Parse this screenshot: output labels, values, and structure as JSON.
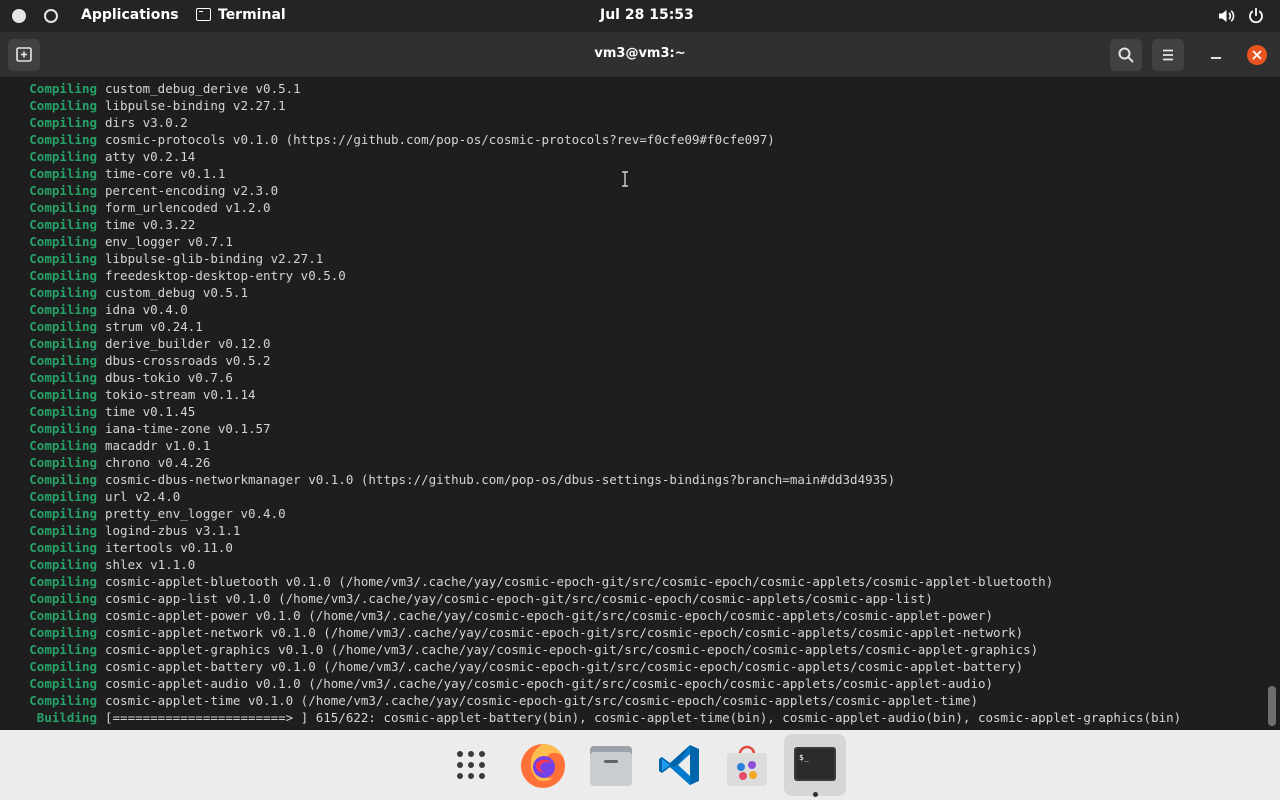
{
  "topbar": {
    "activities_icon": "workspace-dot-icon",
    "applications_label": "Applications",
    "active_app_label": "Terminal",
    "clock": "Jul 28  15:53"
  },
  "window": {
    "title": "vm3@vm3:~"
  },
  "terminal": {
    "status_color": "#26a269",
    "lines": [
      {
        "status": "Compiling",
        "text": "custom_debug_derive v0.5.1"
      },
      {
        "status": "Compiling",
        "text": "libpulse-binding v2.27.1"
      },
      {
        "status": "Compiling",
        "text": "dirs v3.0.2"
      },
      {
        "status": "Compiling",
        "text": "cosmic-protocols v0.1.0 (https://github.com/pop-os/cosmic-protocols?rev=f0cfe09#f0cfe097)"
      },
      {
        "status": "Compiling",
        "text": "atty v0.2.14"
      },
      {
        "status": "Compiling",
        "text": "time-core v0.1.1"
      },
      {
        "status": "Compiling",
        "text": "percent-encoding v2.3.0"
      },
      {
        "status": "Compiling",
        "text": "form_urlencoded v1.2.0"
      },
      {
        "status": "Compiling",
        "text": "time v0.3.22"
      },
      {
        "status": "Compiling",
        "text": "env_logger v0.7.1"
      },
      {
        "status": "Compiling",
        "text": "libpulse-glib-binding v2.27.1"
      },
      {
        "status": "Compiling",
        "text": "freedesktop-desktop-entry v0.5.0"
      },
      {
        "status": "Compiling",
        "text": "custom_debug v0.5.1"
      },
      {
        "status": "Compiling",
        "text": "idna v0.4.0"
      },
      {
        "status": "Compiling",
        "text": "strum v0.24.1"
      },
      {
        "status": "Compiling",
        "text": "derive_builder v0.12.0"
      },
      {
        "status": "Compiling",
        "text": "dbus-crossroads v0.5.2"
      },
      {
        "status": "Compiling",
        "text": "dbus-tokio v0.7.6"
      },
      {
        "status": "Compiling",
        "text": "tokio-stream v0.1.14"
      },
      {
        "status": "Compiling",
        "text": "time v0.1.45"
      },
      {
        "status": "Compiling",
        "text": "iana-time-zone v0.1.57"
      },
      {
        "status": "Compiling",
        "text": "macaddr v1.0.1"
      },
      {
        "status": "Compiling",
        "text": "chrono v0.4.26"
      },
      {
        "status": "Compiling",
        "text": "cosmic-dbus-networkmanager v0.1.0 (https://github.com/pop-os/dbus-settings-bindings?branch=main#dd3d4935)"
      },
      {
        "status": "Compiling",
        "text": "url v2.4.0"
      },
      {
        "status": "Compiling",
        "text": "pretty_env_logger v0.4.0"
      },
      {
        "status": "Compiling",
        "text": "logind-zbus v3.1.1"
      },
      {
        "status": "Compiling",
        "text": "itertools v0.11.0"
      },
      {
        "status": "Compiling",
        "text": "shlex v1.1.0"
      },
      {
        "status": "Compiling",
        "text": "cosmic-applet-bluetooth v0.1.0 (/home/vm3/.cache/yay/cosmic-epoch-git/src/cosmic-epoch/cosmic-applets/cosmic-applet-bluetooth)"
      },
      {
        "status": "Compiling",
        "text": "cosmic-app-list v0.1.0 (/home/vm3/.cache/yay/cosmic-epoch-git/src/cosmic-epoch/cosmic-applets/cosmic-app-list)"
      },
      {
        "status": "Compiling",
        "text": "cosmic-applet-power v0.1.0 (/home/vm3/.cache/yay/cosmic-epoch-git/src/cosmic-epoch/cosmic-applets/cosmic-applet-power)"
      },
      {
        "status": "Compiling",
        "text": "cosmic-applet-network v0.1.0 (/home/vm3/.cache/yay/cosmic-epoch-git/src/cosmic-epoch/cosmic-applets/cosmic-applet-network)"
      },
      {
        "status": "Compiling",
        "text": "cosmic-applet-graphics v0.1.0 (/home/vm3/.cache/yay/cosmic-epoch-git/src/cosmic-epoch/cosmic-applets/cosmic-applet-graphics)"
      },
      {
        "status": "Compiling",
        "text": "cosmic-applet-battery v0.1.0 (/home/vm3/.cache/yay/cosmic-epoch-git/src/cosmic-epoch/cosmic-applets/cosmic-applet-battery)"
      },
      {
        "status": "Compiling",
        "text": "cosmic-applet-audio v0.1.0 (/home/vm3/.cache/yay/cosmic-epoch-git/src/cosmic-epoch/cosmic-applets/cosmic-applet-audio)"
      },
      {
        "status": "Compiling",
        "text": "cosmic-applet-time v0.1.0 (/home/vm3/.cache/yay/cosmic-epoch-git/src/cosmic-epoch/cosmic-applets/cosmic-applet-time)"
      },
      {
        "status": "Building",
        "text": "[=======================> ] 615/622: cosmic-applet-battery(bin), cosmic-applet-time(bin), cosmic-applet-audio(bin), cosmic-applet-graphics(bin)"
      }
    ]
  },
  "dock": {
    "items": [
      {
        "name": "app-grid",
        "icon": "app-grid-icon"
      },
      {
        "name": "firefox",
        "icon": "firefox-icon"
      },
      {
        "name": "files",
        "icon": "files-icon"
      },
      {
        "name": "vscode",
        "icon": "vscode-icon"
      },
      {
        "name": "software-store",
        "icon": "store-icon"
      },
      {
        "name": "terminal",
        "icon": "terminal-icon",
        "running": true
      }
    ]
  }
}
